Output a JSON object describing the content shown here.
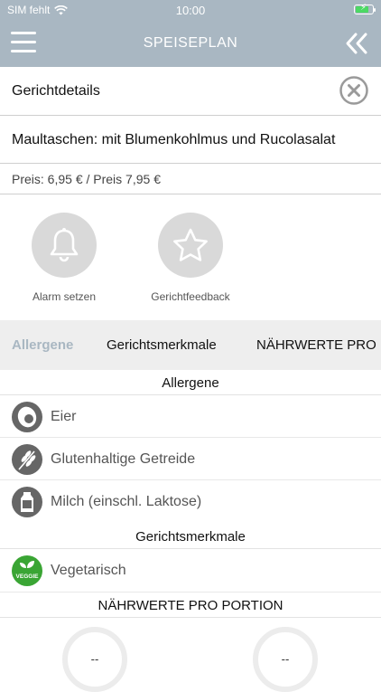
{
  "status_bar": {
    "carrier": "SIM fehlt",
    "time": "10:00"
  },
  "nav": {
    "title": "SPEISEPLAN"
  },
  "detail": {
    "header": "Gerichtdetails",
    "dish_name": "Maultaschen: mit Blumenkohlmus und Rucolasalat",
    "price": "Preis: 6,95 € / Preis 7,95 €"
  },
  "actions": [
    {
      "label": "Alarm setzen",
      "icon": "bell-icon"
    },
    {
      "label": "Gerichtfeedback",
      "icon": "star-icon"
    }
  ],
  "tabs": [
    {
      "label": "Allergene",
      "active": true
    },
    {
      "label": "Gerichtsmerkmale",
      "active": false
    },
    {
      "label": "NÄHRWERTE PRO PORTION",
      "active": false
    }
  ],
  "sections": {
    "allergene": {
      "title": "Allergene",
      "items": [
        {
          "label": "Eier",
          "icon": "egg-icon"
        },
        {
          "label": "Glutenhaltige Getreide",
          "icon": "grain-icon"
        },
        {
          "label": "Milch (einschl. Laktose)",
          "icon": "milk-icon"
        }
      ]
    },
    "merkmale": {
      "title": "Gerichtsmerkmale",
      "items": [
        {
          "label": "Vegetarisch",
          "icon": "veggie-icon",
          "badge_text": "VEGGIE"
        }
      ]
    },
    "naehrwerte": {
      "title": "NÄHRWERTE PRO PORTION",
      "values": [
        "--",
        "--"
      ]
    }
  },
  "colors": {
    "accent": "#a9b7c2",
    "icon_grey": "#d9d9d9",
    "veggie_green": "#3aa534"
  }
}
